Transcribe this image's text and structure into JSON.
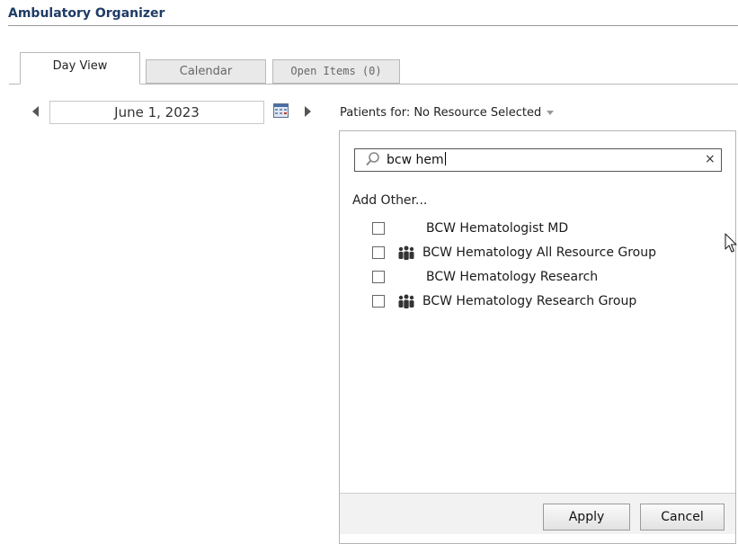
{
  "app": {
    "title": "Ambulatory Organizer"
  },
  "tabs": [
    {
      "label": "Day View",
      "active": true
    },
    {
      "label": "Calendar",
      "active": false
    },
    {
      "label": "Open Items (0)",
      "active": false
    }
  ],
  "date_nav": {
    "date": "June 1, 2023"
  },
  "patients_for": {
    "label": "Patients for: No Resource Selected"
  },
  "search": {
    "value": "bcw hem",
    "clear_label": "×"
  },
  "add_other": {
    "label": "Add Other..."
  },
  "results": [
    {
      "label": "BCW Hematologist MD",
      "is_group": false,
      "checked": false
    },
    {
      "label": "BCW Hematology All Resource Group",
      "is_group": true,
      "checked": false
    },
    {
      "label": "BCW Hematology Research",
      "is_group": false,
      "checked": false
    },
    {
      "label": "BCW Hematology Research Group",
      "is_group": true,
      "checked": false
    }
  ],
  "footer": {
    "apply_label": "Apply",
    "cancel_label": "Cancel"
  },
  "colors": {
    "title": "#1f3c66",
    "tab_inactive_bg": "#e9e9e9",
    "panel_border": "#b5b5b5"
  },
  "icons": [
    "arrow-left-icon",
    "calendar-icon",
    "arrow-right-icon",
    "search-icon",
    "group-icon",
    "mouse-cursor-icon"
  ]
}
